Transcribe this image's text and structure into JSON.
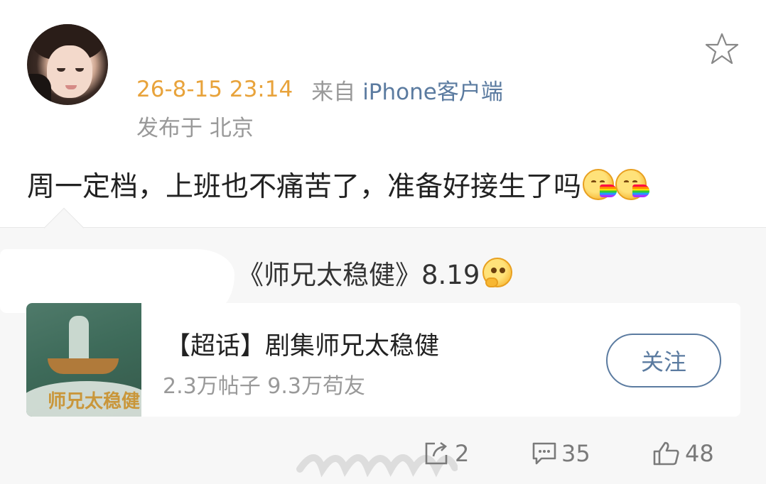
{
  "post": {
    "time": "26-8-15 23:14",
    "from_label": "来自",
    "source": "iPhone客户端",
    "location": "发布于 北京",
    "text": "周一定档，上班也不痛苦了，准备好接生了吗",
    "text_emojis": [
      "rainbow-kiss-emoji",
      "rainbow-kiss-emoji"
    ]
  },
  "repost": {
    "text": "《师兄太稳健》8.19",
    "emoji": "thinking-emoji",
    "card": {
      "title": "【超话】剧集师兄太稳健",
      "stats": "2.3万帖子 9.3万苟友",
      "follow_label": "关注"
    }
  },
  "actions": {
    "share_count": "2",
    "comment_count": "35",
    "like_count": "48"
  },
  "colors": {
    "time": "#e8a33b",
    "link": "#5b7ba0",
    "muted": "#999999",
    "repost_bg": "#f7f7f7"
  }
}
